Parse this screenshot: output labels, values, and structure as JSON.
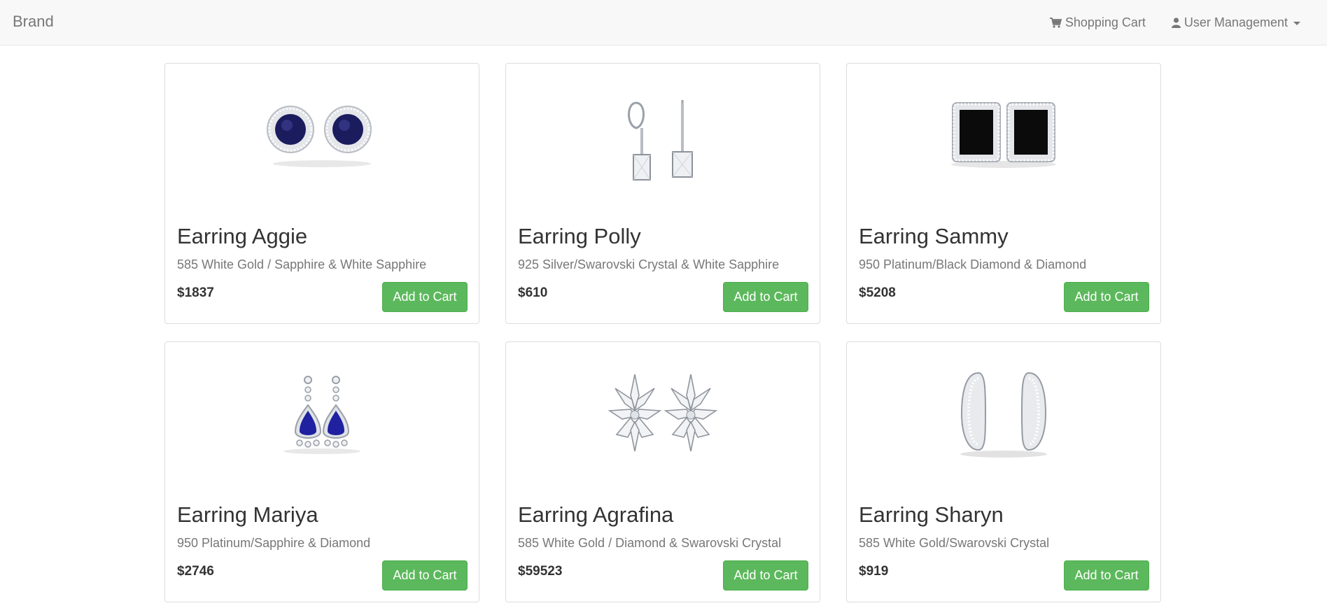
{
  "navbar": {
    "brand": "Brand",
    "cart_label": "Shopping Cart",
    "user_label": "User Management"
  },
  "products": [
    {
      "name": "Earring Aggie",
      "description": "585 White Gold / Sapphire & White Sapphire",
      "price": "$1837",
      "button": "Add to Cart",
      "image": "round-sapphire-halo-studs-image"
    },
    {
      "name": "Earring Polly",
      "description": "925 Silver/Swarovski Crystal & White Sapphire",
      "price": "$610",
      "button": "Add to Cart",
      "image": "crystal-drop-earrings-image"
    },
    {
      "name": "Earring Sammy",
      "description": "950 Platinum/Black Diamond & Diamond",
      "price": "$5208",
      "button": "Add to Cart",
      "image": "black-diamond-halo-studs-image"
    },
    {
      "name": "Earring Mariya",
      "description": "950 Platinum/Sapphire & Diamond",
      "price": "$2746",
      "button": "Add to Cart",
      "image": "pear-sapphire-drop-earrings-image"
    },
    {
      "name": "Earring Agrafina",
      "description": "585 White Gold / Diamond & Swarovski Crystal",
      "price": "$59523",
      "button": "Add to Cart",
      "image": "floral-diamond-earrings-image"
    },
    {
      "name": "Earring Sharyn",
      "description": "585 White Gold/Swarovski Crystal",
      "price": "$919",
      "button": "Add to Cart",
      "image": "pave-hoop-earrings-image"
    }
  ],
  "colors": {
    "button": "#5cb85c",
    "navbar_bg": "#f8f8f8",
    "sapphire": "#1f1f7a",
    "black_stone": "#111111"
  }
}
